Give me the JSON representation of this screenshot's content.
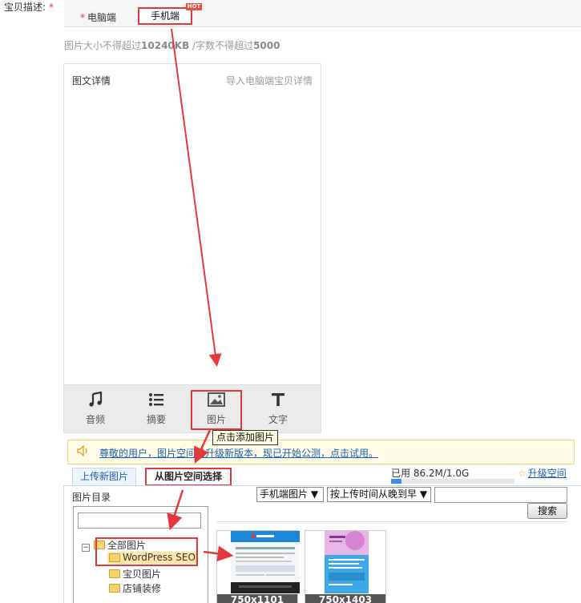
{
  "field": {
    "label": "宝贝描述:",
    "required_mark": "*"
  },
  "tabs": {
    "pc_required": "*",
    "pc_label": "电脑端",
    "mobile_label": "手机端",
    "hot_badge": "HOT"
  },
  "limits": {
    "prefix": "图片大小不得超过",
    "size": "10240KB",
    "middle": " /字数不得超过",
    "words": "5000"
  },
  "editor": {
    "title": "图文详情",
    "import_link": "导入电脑端宝贝详情"
  },
  "toolbar": [
    {
      "label": "音频",
      "icon": "music-note-icon"
    },
    {
      "label": "摘要",
      "icon": "list-icon"
    },
    {
      "label": "图片",
      "icon": "image-icon"
    },
    {
      "label": "文字",
      "icon": "text-t-icon"
    }
  ],
  "tooltip": "点击添加图片",
  "notice": {
    "icon": "speaker-icon",
    "text": "尊敬的用户，图片空间已升级新版本，现已开始公测，点击试用。"
  },
  "picker": {
    "tab_upload": "上传新图片",
    "tab_space": "从图片空间选择",
    "quota_label": "已用 86.2M/1.0G",
    "quota_fraction": 0.084,
    "upgrade_label": "升级空间",
    "dir_title": "图片目录",
    "category_select": "手机端图片 ▼",
    "sort_select": "按上传时间从晚到早 ▼",
    "search_placeholder": "",
    "search_button": "搜索",
    "tree": {
      "root_toggle": "−",
      "items": [
        "全部图片",
        "WordPress SEO",
        "宝贝图片",
        "店铺装修"
      ]
    },
    "thumbs": [
      {
        "size": "750x1101"
      },
      {
        "size": "750x1403"
      }
    ]
  },
  "colors": {
    "accent_red": "#e4393c",
    "link_blue": "#1a5fb4",
    "notice_bg": "#fffbe6"
  }
}
